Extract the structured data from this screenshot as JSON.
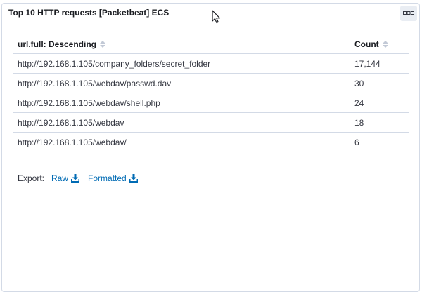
{
  "panel": {
    "title": "Top 10 HTTP requests [Packetbeat] ECS"
  },
  "table": {
    "columns": [
      {
        "label": "url.full: Descending",
        "sort_icon": "sort-icon"
      },
      {
        "label": "Count",
        "sort_icon": "sort-icon"
      }
    ],
    "rows": [
      {
        "url": "http://192.168.1.105/company_folders/secret_folder",
        "count": "17,144"
      },
      {
        "url": "http://192.168.1.105/webdav/passwd.dav",
        "count": "30"
      },
      {
        "url": "http://192.168.1.105/webdav/shell.php",
        "count": "24"
      },
      {
        "url": "http://192.168.1.105/webdav",
        "count": "18"
      },
      {
        "url": "http://192.168.1.105/webdav/",
        "count": "6"
      }
    ]
  },
  "export": {
    "label": "Export:",
    "raw_label": "Raw",
    "formatted_label": "Formatted",
    "icon": "download-icon"
  },
  "colors": {
    "link": "#006bb4",
    "text": "#343741",
    "border": "#d3dae6",
    "title": "#1a1c21"
  }
}
